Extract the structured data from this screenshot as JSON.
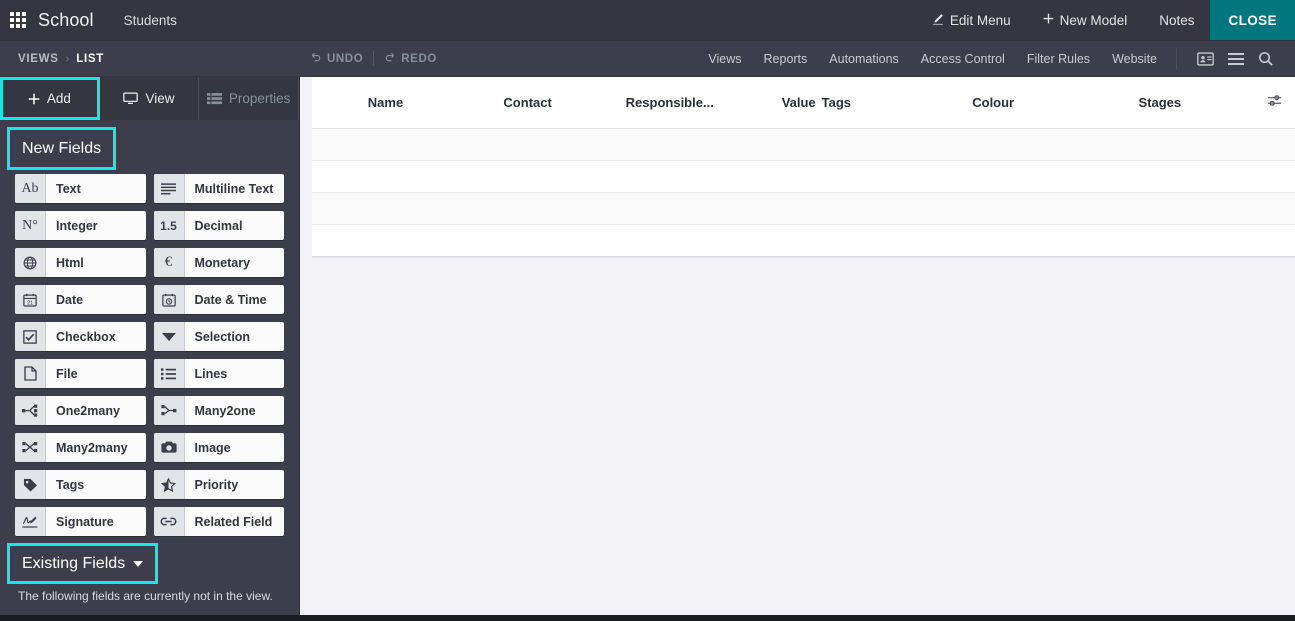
{
  "navbar": {
    "apps_icon": "apps-grid-icon",
    "brand": "School",
    "menu_items": [
      {
        "label": "Students"
      }
    ],
    "actions": [
      {
        "label": "Edit Menu",
        "icon": "pencil-icon",
        "glyph": "✎"
      },
      {
        "label": "New Model",
        "icon": "plus-icon",
        "glyph": "✚"
      },
      {
        "label": "Notes",
        "icon": "",
        "glyph": ""
      }
    ],
    "close_label": "CLOSE",
    "close_color": "#00777e"
  },
  "subbar": {
    "breadcrumb": {
      "root": "VIEWS",
      "separator": "›",
      "current": "LIST"
    },
    "undo_label": "UNDO",
    "redo_label": "REDO",
    "menu_items": [
      {
        "label": "Views"
      },
      {
        "label": "Reports"
      },
      {
        "label": "Automations"
      },
      {
        "label": "Access Control"
      },
      {
        "label": "Filter Rules"
      },
      {
        "label": "Website"
      }
    ],
    "icons": [
      {
        "name": "contact-card-icon"
      },
      {
        "name": "list-view-icon"
      },
      {
        "name": "search-icon"
      }
    ]
  },
  "sidebar": {
    "tabs": [
      {
        "label": "Add",
        "icon": "plus-icon",
        "selected": true,
        "dim": false
      },
      {
        "label": "View",
        "icon": "monitor-icon",
        "selected": false,
        "dim": false
      },
      {
        "label": "Properties",
        "icon": "properties-icon",
        "selected": false,
        "dim": true
      }
    ],
    "new_fields_title": "New Fields",
    "new_fields": [
      {
        "label": "Text",
        "icon": "text-ab-icon",
        "glyph": "Ab"
      },
      {
        "label": "Multiline Text",
        "icon": "multiline-text-icon",
        "glyph": ""
      },
      {
        "label": "Integer",
        "icon": "integer-icon",
        "glyph": "N°"
      },
      {
        "label": "Decimal",
        "icon": "decimal-icon",
        "glyph": "1.5"
      },
      {
        "label": "Html",
        "icon": "globe-icon",
        "glyph": ""
      },
      {
        "label": "Monetary",
        "icon": "euro-icon",
        "glyph": "€"
      },
      {
        "label": "Date",
        "icon": "calendar-icon",
        "glyph": "21"
      },
      {
        "label": "Date & Time",
        "icon": "calendar-clock-icon",
        "glyph": ""
      },
      {
        "label": "Checkbox",
        "icon": "checkbox-icon",
        "glyph": ""
      },
      {
        "label": "Selection",
        "icon": "caret-down-icon",
        "glyph": ""
      },
      {
        "label": "File",
        "icon": "file-icon",
        "glyph": ""
      },
      {
        "label": "Lines",
        "icon": "bullet-list-icon",
        "glyph": ""
      },
      {
        "label": "One2many",
        "icon": "one2many-icon",
        "glyph": ""
      },
      {
        "label": "Many2one",
        "icon": "many2one-icon",
        "glyph": ""
      },
      {
        "label": "Many2many",
        "icon": "many2many-icon",
        "glyph": ""
      },
      {
        "label": "Image",
        "icon": "camera-icon",
        "glyph": ""
      },
      {
        "label": "Tags",
        "icon": "tag-icon",
        "glyph": ""
      },
      {
        "label": "Priority",
        "icon": "half-star-icon",
        "glyph": ""
      },
      {
        "label": "Signature",
        "icon": "signature-icon",
        "glyph": ""
      },
      {
        "label": "Related Field",
        "icon": "link-icon",
        "glyph": ""
      }
    ],
    "existing_fields_title": "Existing Fields",
    "existing_fields_note": "The following fields are currently not in the view.",
    "highlight_color": "#19e6e6"
  },
  "main": {
    "columns": [
      {
        "label": "Name",
        "align": "center"
      },
      {
        "label": "Contact",
        "align": "center"
      },
      {
        "label": "Responsible...",
        "align": "center"
      },
      {
        "label": "Value",
        "align": "right"
      },
      {
        "label": "Tags",
        "align": "center"
      },
      {
        "label": "Colour",
        "align": "center"
      },
      {
        "label": "Stages",
        "align": "center"
      }
    ],
    "options_icon": "column-settings-icon",
    "rows": [
      {
        "cells": [
          "",
          "",
          "",
          "",
          "",
          "",
          ""
        ]
      },
      {
        "cells": [
          "",
          "",
          "",
          "",
          "",
          "",
          ""
        ]
      },
      {
        "cells": [
          "",
          "",
          "",
          "",
          "",
          "",
          ""
        ]
      },
      {
        "cells": [
          "",
          "",
          "",
          "",
          "",
          "",
          ""
        ]
      }
    ]
  }
}
